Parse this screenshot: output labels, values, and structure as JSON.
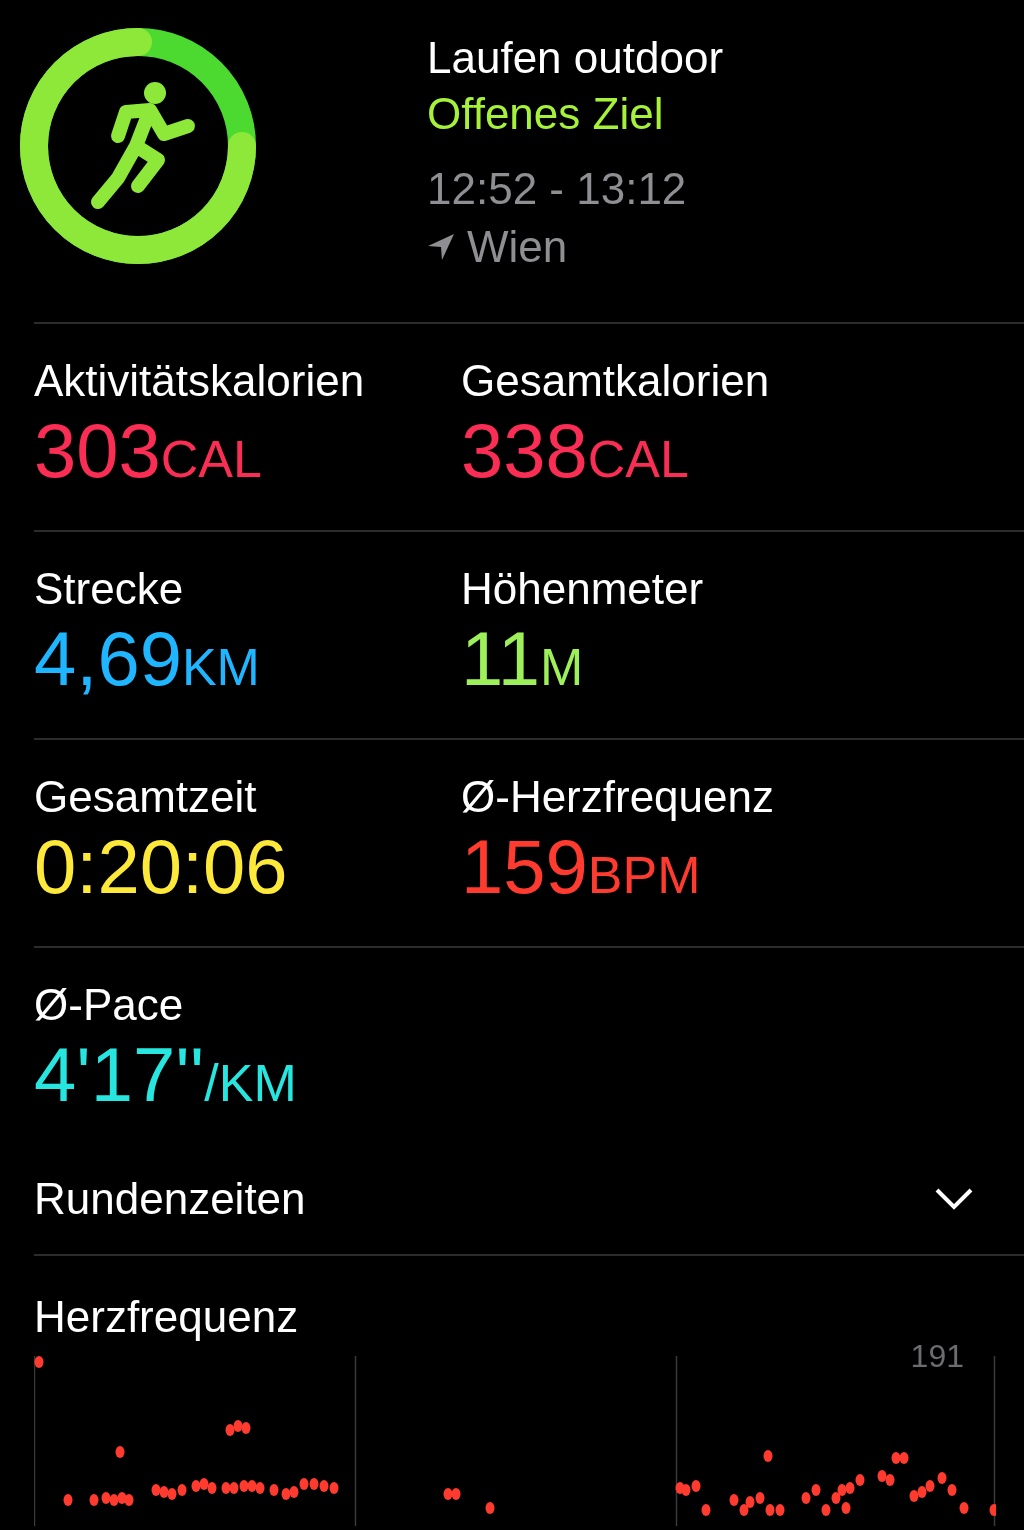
{
  "workout": {
    "title": "Laufen outdoor",
    "goal": "Offenes Ziel",
    "time": "12:52 - 13:12",
    "location": "Wien"
  },
  "metric_rows": [
    [
      {
        "label": "Aktivitätskalorien",
        "value": "303",
        "unit": "CAL",
        "color": "#fa2d55"
      },
      {
        "label": "Gesamtkalorien",
        "value": "338",
        "unit": "CAL",
        "color": "#fa2d55"
      }
    ],
    [
      {
        "label": "Strecke",
        "value": "4,69",
        "unit": "KM",
        "color": "#1fb6ff"
      },
      {
        "label": "Höhenmeter",
        "value": "11",
        "unit": "M",
        "color": "#9ef05a"
      }
    ],
    [
      {
        "label": "Gesamtzeit",
        "value": "0:20:06",
        "color": "#fde93a"
      },
      {
        "label": "Ø-Herzfrequenz",
        "value": "159",
        "unit": "BPM",
        "color": "#ff3b2f"
      }
    ],
    [
      {
        "label": "Ø-Pace",
        "value": "4'17''",
        "unit": "/KM",
        "color": "#27e6e0"
      }
    ]
  ],
  "laps": {
    "label": "Rundenzeiten",
    "expanded": false
  },
  "heart_rate": {
    "title": "Herzfrequenz",
    "max_label": "191"
  }
}
